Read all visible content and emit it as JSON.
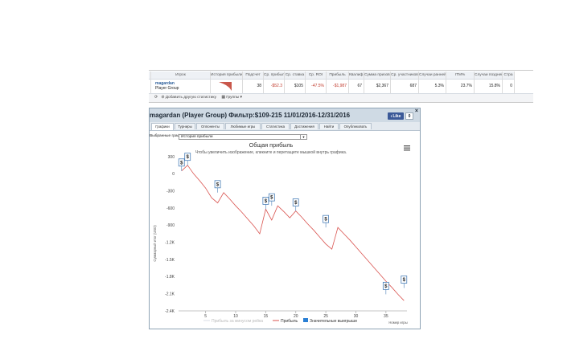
{
  "table": {
    "headers": [
      "Игрок",
      "История прибыли",
      "Подсчет",
      "Ср. прибыль",
      "Ср. ставка",
      "Ср. ROI",
      "Прибыль",
      "Квалиф.",
      "Сумма призовых",
      "Ср. участников",
      "Случаи ранней",
      "ITM%",
      "Случаи поздней",
      "Стра"
    ],
    "row": {
      "player_name": "magardan",
      "player_group": "Player Group",
      "count": "38",
      "avg_profit": "-$52.3",
      "avg_stake": "$105",
      "avg_roi": "-47.5%",
      "profit": "-$1,987",
      "qualified": "67",
      "prize_sum": "$2,367",
      "avg_entrants": "687",
      "early_cases": "5.3%",
      "itm": "23.7%",
      "late_cases": "15.8%",
      "extra": "0"
    },
    "footer": {
      "add_stat": "Добавить другую статистику",
      "groups": "Группы"
    }
  },
  "window": {
    "title": "magardan (Player Group) Фильтр:$109-215 11/01/2016-12/31/2016",
    "fb_like": "Like",
    "fb_count": "0",
    "close": "×",
    "tabs": [
      "Графики",
      "Турниры",
      "Оппоненты",
      "Любимые игры",
      "Статистика",
      "Достижения",
      "Найти",
      "Опубликовать"
    ],
    "select_label": "Выбранные графики:",
    "select_value": "История прибыли"
  },
  "chart_data": {
    "type": "line",
    "title": "Общая прибыль",
    "subtitle": "Чтобы увеличить изображение, кликните и перетащите мышкой внутрь графика.",
    "xlabel": "Номер игры",
    "ylabel": "Суммарный итог (USD)",
    "xlim": [
      0.5,
      38.5
    ],
    "ylim": [
      -2400,
      300
    ],
    "x_ticks": [
      5,
      10,
      15,
      20,
      25,
      30,
      35
    ],
    "y_ticks": [
      300,
      0,
      -300,
      -600,
      -900,
      -1200,
      -1500,
      -1800,
      -2100,
      -2400
    ],
    "y_tick_labels": [
      "300",
      "0",
      "-300",
      "-600",
      "-900",
      "-1.2K",
      "-1.5K",
      "-1.8K",
      "-2.1K",
      "-2.4K"
    ],
    "grid": false,
    "legend": [
      "Прибыль за минусом рейка",
      "Прибыль",
      "Значительные выигрыши"
    ],
    "series": [
      {
        "name": "Прибыль",
        "color": "#d9534f",
        "x": [
          1,
          2,
          3,
          4,
          5,
          6,
          7,
          8,
          9,
          10,
          11,
          12,
          13,
          14,
          15,
          16,
          17,
          18,
          19,
          20,
          21,
          22,
          23,
          24,
          25,
          26,
          27,
          28,
          29,
          30,
          31,
          32,
          33,
          34,
          35,
          36,
          37,
          38
        ],
        "y": [
          50,
          150,
          0,
          -120,
          -250,
          -420,
          -510,
          -330,
          -440,
          -560,
          -670,
          -790,
          -910,
          -1050,
          -620,
          -810,
          -560,
          -660,
          -770,
          -650,
          -760,
          -880,
          -990,
          -1110,
          -1230,
          -1320,
          -940,
          -1050,
          -1160,
          -1280,
          -1400,
          -1520,
          -1640,
          -1760,
          -1880,
          -1990,
          -2110,
          -2220
        ]
      }
    ],
    "big_wins": [
      {
        "x": 1,
        "y": 50
      },
      {
        "x": 2,
        "y": 150
      },
      {
        "x": 7,
        "y": -330
      },
      {
        "x": 15,
        "y": -620
      },
      {
        "x": 16,
        "y": -560
      },
      {
        "x": 20,
        "y": -650
      },
      {
        "x": 25,
        "y": -940
      },
      {
        "x": 35,
        "y": -2110
      },
      {
        "x": 38,
        "y": -2000
      }
    ]
  }
}
